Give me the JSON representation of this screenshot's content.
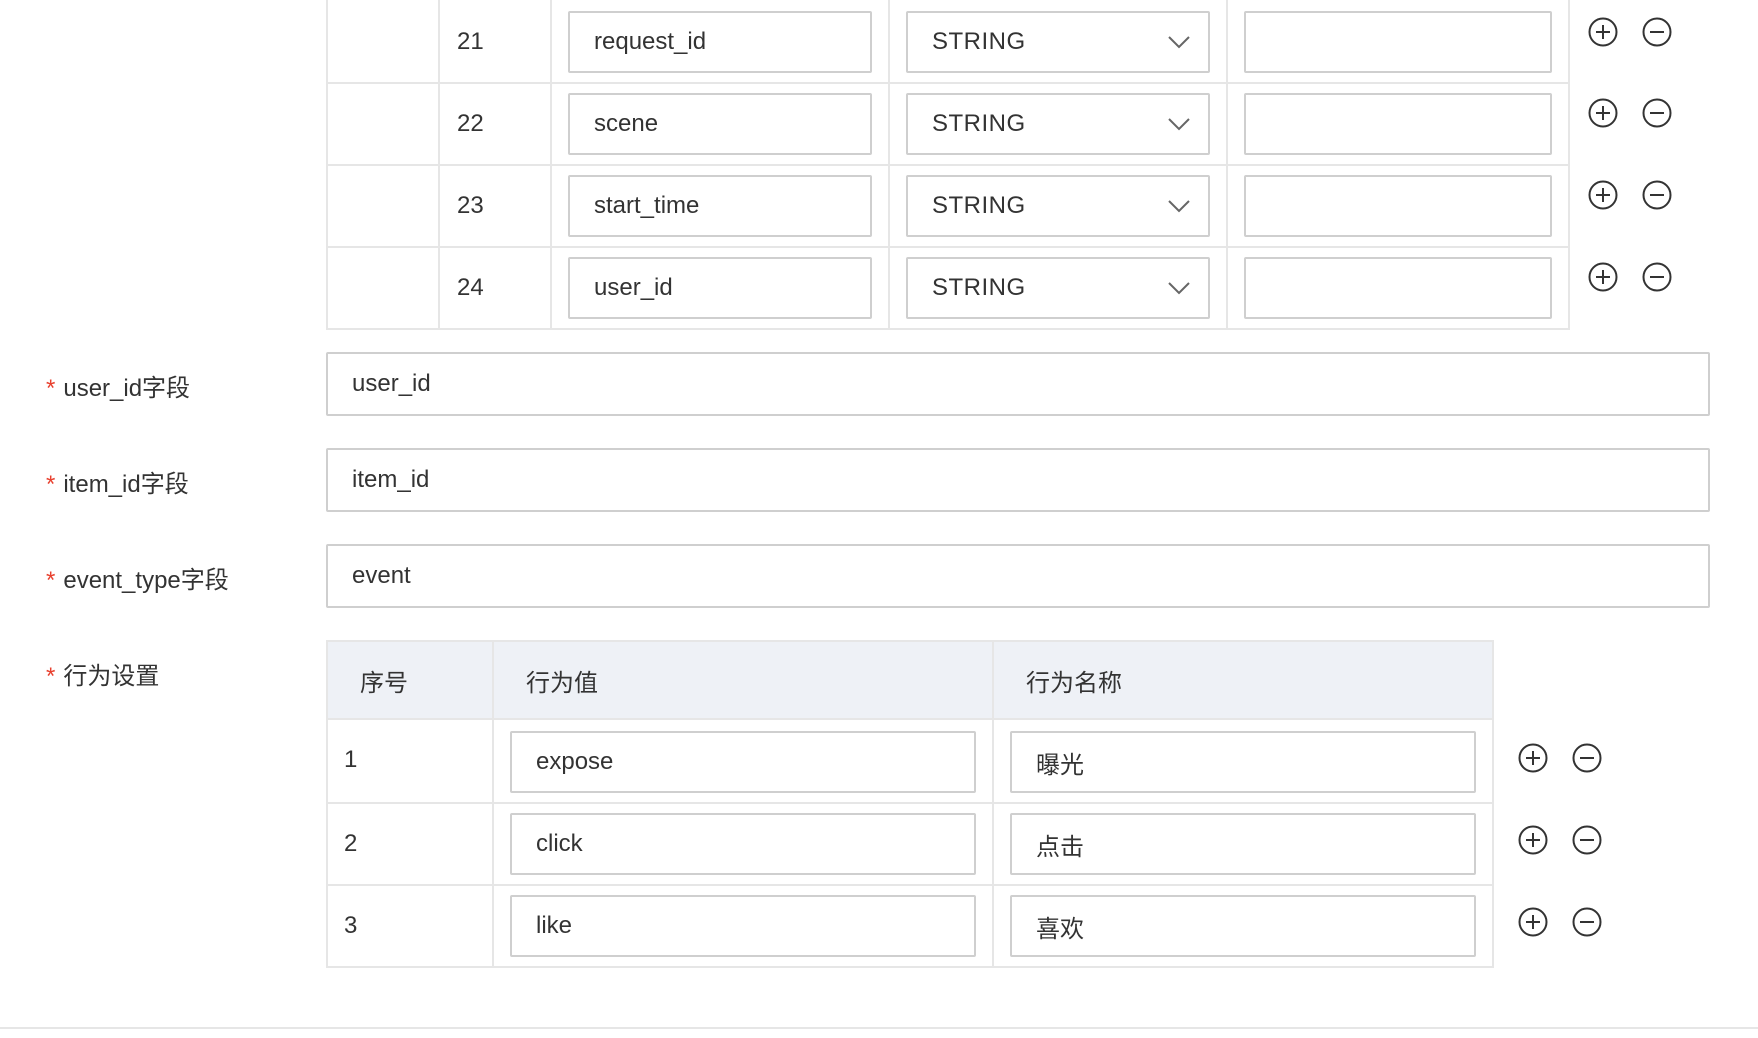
{
  "field_rows": [
    {
      "index": "21",
      "name": "request_id",
      "type": "STRING",
      "extra": ""
    },
    {
      "index": "22",
      "name": "scene",
      "type": "STRING",
      "extra": ""
    },
    {
      "index": "23",
      "name": "start_time",
      "type": "STRING",
      "extra": ""
    },
    {
      "index": "24",
      "name": "user_id",
      "type": "STRING",
      "extra": ""
    }
  ],
  "form": {
    "required_mark": "*",
    "user_id_label": "user_id字段",
    "user_id_value": "user_id",
    "item_id_label": "item_id字段",
    "item_id_value": "item_id",
    "event_type_label": "event_type字段",
    "event_type_value": "event",
    "behavior_label": "行为设置"
  },
  "behavior_table": {
    "headers": [
      "序号",
      "行为值",
      "行为名称"
    ],
    "rows": [
      {
        "index": "1",
        "value": "expose",
        "name": "曝光"
      },
      {
        "index": "2",
        "value": "click",
        "name": "点击"
      },
      {
        "index": "3",
        "value": "like",
        "name": "喜欢"
      }
    ]
  },
  "icons": {
    "add": "plus-circle-icon",
    "remove": "minus-circle-icon",
    "dropdown": "chevron-down-icon"
  },
  "colors": {
    "required": "#e8402e",
    "border": "#cfcfcf",
    "header_bg": "#eef1f6"
  }
}
